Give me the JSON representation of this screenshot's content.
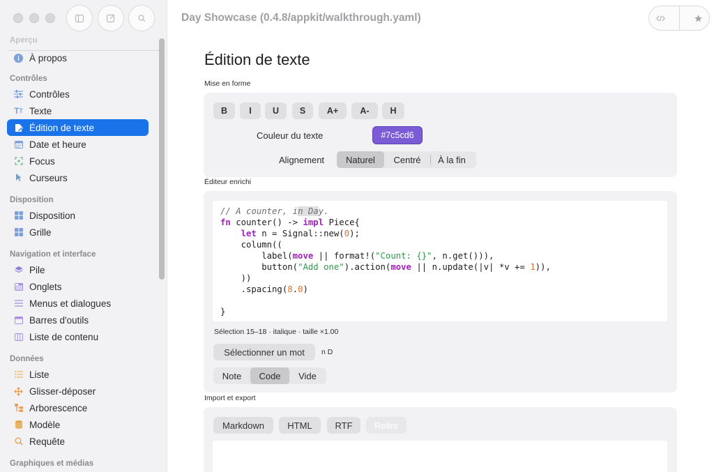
{
  "window": {
    "title": "Day Showcase (0.4.8/appkit/walkthrough.yaml)"
  },
  "sidebar": {
    "partial_top": "Aperçu",
    "groups": [
      {
        "heading": "",
        "items": [
          {
            "label": "À propos",
            "icon": "info-icon"
          }
        ]
      },
      {
        "heading": "Contrôles",
        "items": [
          {
            "label": "Contrôles",
            "icon": "sliders-icon"
          },
          {
            "label": "Texte",
            "icon": "text-icon"
          },
          {
            "label": "Édition de texte",
            "icon": "edit-icon"
          },
          {
            "label": "Date et heure",
            "icon": "calendar-icon"
          },
          {
            "label": "Focus",
            "icon": "focus-icon"
          },
          {
            "label": "Curseurs",
            "icon": "cursor-icon"
          }
        ]
      },
      {
        "heading": "Disposition",
        "items": [
          {
            "label": "Disposition",
            "icon": "layout-icon"
          },
          {
            "label": "Grille",
            "icon": "grid-icon"
          }
        ]
      },
      {
        "heading": "Navigation et interface",
        "items": [
          {
            "label": "Pile",
            "icon": "stack-icon"
          },
          {
            "label": "Onglets",
            "icon": "tabs-icon"
          },
          {
            "label": "Menus et dialogues",
            "icon": "menu-icon"
          },
          {
            "label": "Barres d'outils",
            "icon": "toolbar-icon"
          },
          {
            "label": "Liste de contenu",
            "icon": "columns-icon"
          }
        ]
      },
      {
        "heading": "Données",
        "items": [
          {
            "label": "Liste",
            "icon": "list-icon"
          },
          {
            "label": "Glisser-déposer",
            "icon": "move-icon"
          },
          {
            "label": "Arborescence",
            "icon": "tree-icon"
          },
          {
            "label": "Modèle",
            "icon": "database-icon"
          },
          {
            "label": "Requête",
            "icon": "search-icon"
          }
        ]
      }
    ],
    "partial_bottom": "Graphiques et médias"
  },
  "main": {
    "title": "Édition de texte",
    "format_group": {
      "label": "Mise en forme",
      "buttons": [
        "B",
        "I",
        "U",
        "S",
        "A+",
        "A-",
        "H"
      ],
      "color_label": "Couleur du texte",
      "color_value": "#7c5cd6",
      "align_label": "Alignement",
      "align_options": [
        "Naturel",
        "Centré",
        "À la fin"
      ],
      "align_selected": "Naturel"
    },
    "rich_group": {
      "label": "Éditeur enrichi",
      "selection_status": "Sélection 15–18 · italique · taille ×1.00",
      "select_word_button": "Sélectionner un mot",
      "hint": "n D",
      "mode_options": [
        "Note",
        "Code",
        "Vide"
      ],
      "mode_selected": "Code"
    },
    "export_group": {
      "label": "Import et export",
      "buttons": [
        "Markdown",
        "HTML",
        "RTF",
        "Relire"
      ]
    }
  },
  "accent_color": "#1a73e8"
}
